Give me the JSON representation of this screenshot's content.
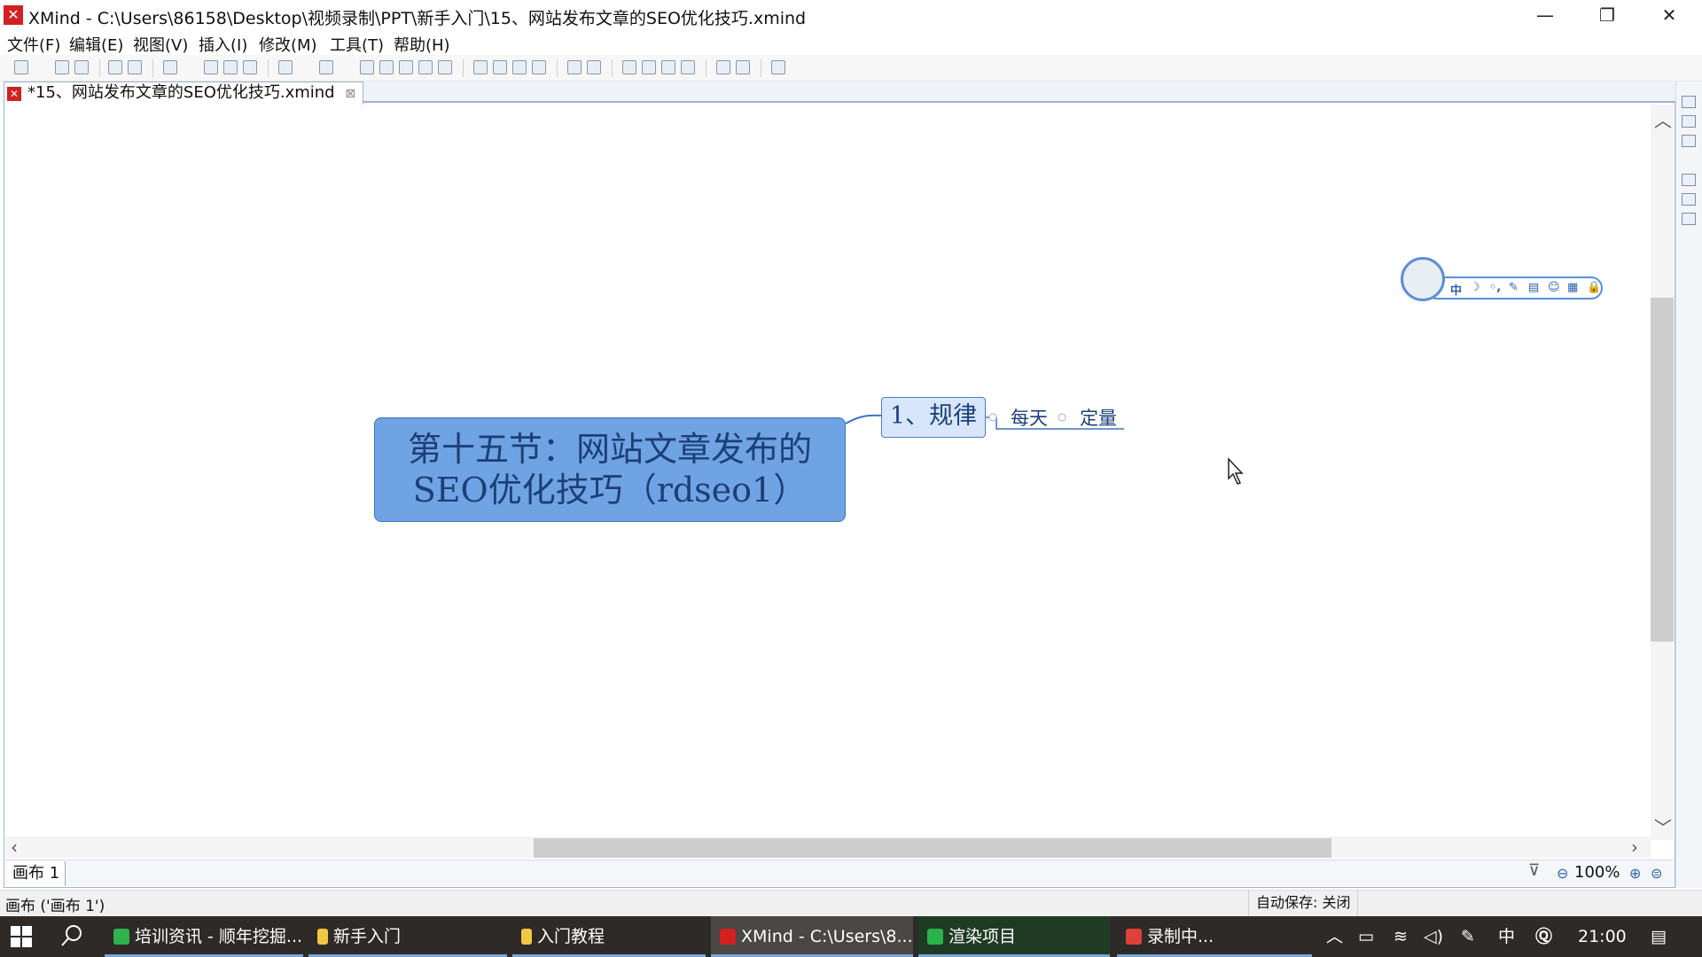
{
  "window": {
    "title": "XMind - C:\\Users\\86158\\Desktop\\视频录制\\PPT\\新手入门\\15、网站发布文章的SEO优化技巧.xmind",
    "app_icon": "xmind-logo",
    "minimize": "—",
    "restore": "❐",
    "close": "✕"
  },
  "menu": [
    "文件(F)",
    "编辑(E)",
    "视图(V)",
    "插入(I)",
    "修改(M)",
    "工具(T)",
    "帮助(H)"
  ],
  "editor": {
    "tab_label": "*15、网站发布文章的SEO优化技巧.xmind",
    "tab_close": "⊠"
  },
  "mindmap": {
    "central_topic": {
      "line1": "第十五节：网站文章发布的",
      "line2": "SEO优化技巧（rdseo1）"
    },
    "main_topic": "1、规律",
    "subtopics": [
      "每天",
      "定量"
    ],
    "colors": {
      "central_fill": "#6fa3e3",
      "main_fill": "#d7e6fb",
      "text": "#1c3f78",
      "connector": "#3f74bd"
    }
  },
  "ime_bar": {
    "items": [
      "中",
      "☽",
      "◦,",
      "✎",
      "▤",
      "☺",
      "▦",
      "🔒"
    ]
  },
  "sheet": {
    "tab_label": "画布 1",
    "zoom": "100%",
    "zoom_out": "⊖",
    "zoom_in": "⊕",
    "zoom_reset": "⊜"
  },
  "status": {
    "left": "画布 ('画布 1')",
    "autosave": "自动保存: 关闭"
  },
  "taskbar": {
    "items": [
      {
        "label": "培训资讯 - 顺年挖掘...",
        "color": "#2fb24f"
      },
      {
        "label": "新手入门",
        "color": "#f2c744"
      },
      {
        "label": "入门教程",
        "color": "#f2c744"
      },
      {
        "label": "XMind - C:\\Users\\8...",
        "color": "#d32020"
      },
      {
        "label": "渲染项目",
        "color": "#29b34a"
      },
      {
        "label": "录制中...",
        "color": "#e0403a"
      }
    ],
    "tray": {
      "ime": "中",
      "clock": "21:00"
    }
  }
}
